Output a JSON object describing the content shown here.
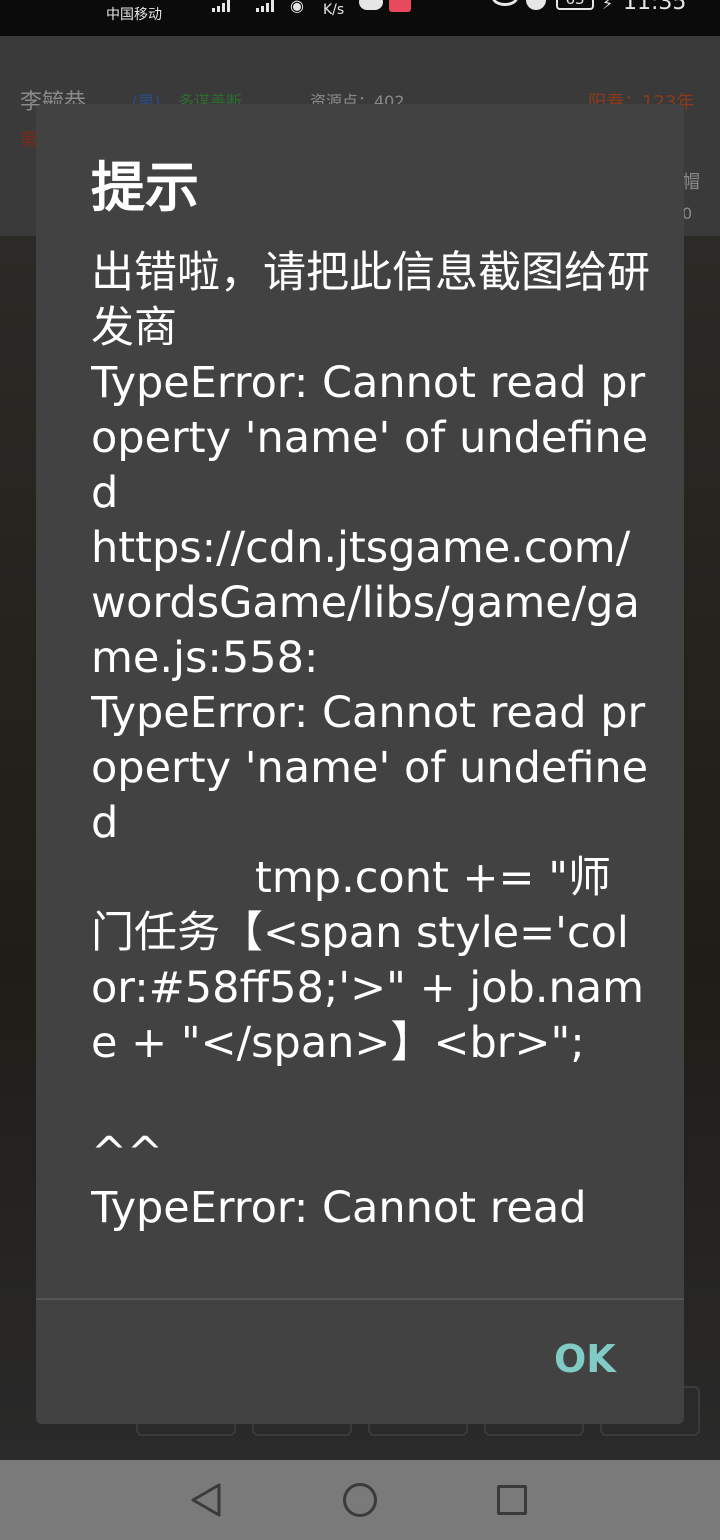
{
  "status_bar": {
    "carrier": "中国移动",
    "speed_unit": "K/s",
    "battery": "63",
    "time": "11:35"
  },
  "game": {
    "player_name": "李毓恭",
    "gender": "(男)",
    "trait": "多谋善断",
    "resource": "资源点：402",
    "lifespan": "阳寿：123年",
    "row2_left": "第",
    "side_top": "帽",
    "side_bottom": "0"
  },
  "dialog": {
    "title": "提示",
    "message": "出错啦，请把此信息截图给研发商\nTypeError: Cannot read property 'name' of undefined\nhttps://cdn.jtsgame.com/wordsGame/libs/game/game.js:558:\nTypeError: Cannot read property 'name' of undefined\n            tmp.cont += \"师门任务【<span style='color:#58ff58;'>\" + job.name + \"</span>】<br>\";\n\n^^\nTypeError: Cannot read",
    "ok_label": "OK"
  },
  "colors": {
    "dialog_bg": "#424242",
    "accent": "#80cbc4",
    "navbar_bg": "#7a7a7a"
  },
  "icons": {
    "nav_back": "back-triangle-icon",
    "nav_home": "home-circle-icon",
    "nav_recent": "recent-square-icon"
  }
}
